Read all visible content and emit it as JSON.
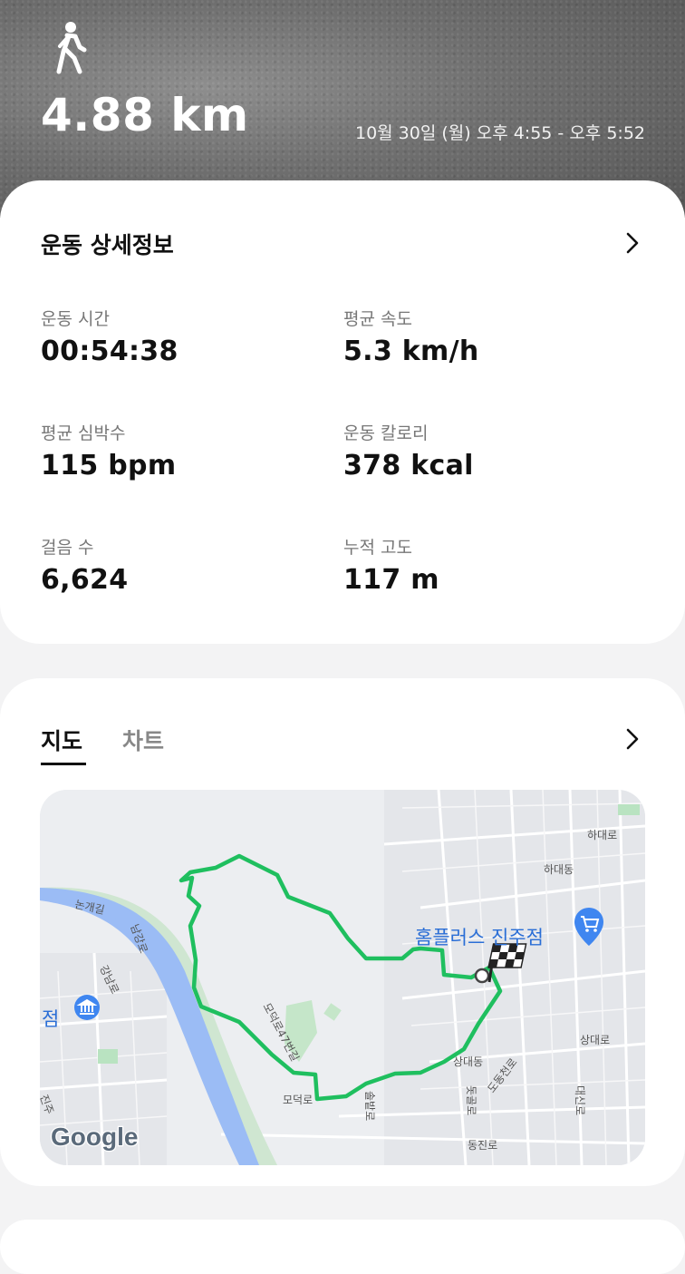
{
  "header": {
    "activity_icon": "walk-icon",
    "distance": "4.88 km",
    "datetime": "10월 30일 (월) 오후 4:55 - 오후 5:52"
  },
  "details": {
    "title": "운동 상세정보",
    "stats": [
      {
        "label": "운동 시간",
        "value": "00:54:38"
      },
      {
        "label": "평균 속도",
        "value": "5.3 km/h"
      },
      {
        "label": "평균 심박수",
        "value": "115 bpm"
      },
      {
        "label": "운동 칼로리",
        "value": "378 kcal"
      },
      {
        "label": "걸음 수",
        "value": "6,624"
      },
      {
        "label": "누적 고도",
        "value": "117 m"
      }
    ]
  },
  "map_section": {
    "tabs": [
      {
        "label": "지도",
        "active": true
      },
      {
        "label": "차트",
        "active": false
      }
    ],
    "map": {
      "place_name": "홈플러스 진주점",
      "logo": "Google",
      "labels": [
        "논개길",
        "남강로",
        "강남로",
        "점",
        "모덕로47번길",
        "모덕로",
        "솔밭로",
        "돗골로",
        "도동천로",
        "동진로",
        "상대동",
        "상대로",
        "하대로",
        "하대동",
        "대신로",
        "진주"
      ],
      "route_color": "#1fbf5f",
      "river_color": "#9bbcf5"
    }
  }
}
